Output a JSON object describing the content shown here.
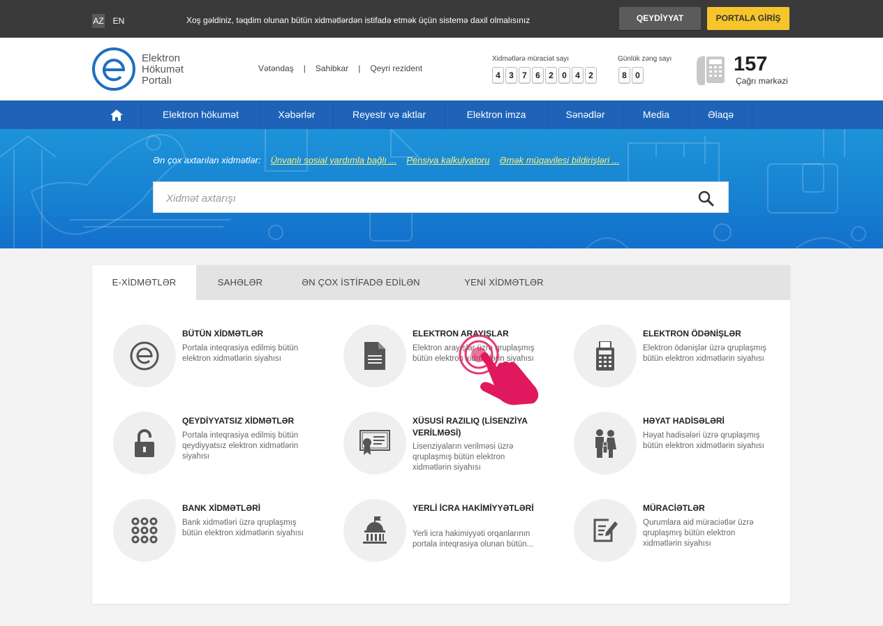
{
  "topbar": {
    "lang_az": "AZ",
    "lang_en": "EN",
    "welcome": "Xoş gəldiniz, təqdim olunan bütün xidmətlərdən istifadə etmək üçün sistemə daxil olmalısınız",
    "register_label": "QEYDİYYAT",
    "login_label": "PORTALA GİRİŞ"
  },
  "header": {
    "logo_line1": "Elektron",
    "logo_line2": "Hökumət",
    "logo_line3": "Portalı",
    "user_types": [
      "Vətəndaş",
      "Sahibkar",
      "Qeyri rezident"
    ],
    "requests_label": "Xidmətlərə müraciət sayı",
    "requests_digits": [
      "4",
      "3",
      "7",
      "6",
      "2",
      "0",
      "4",
      "2"
    ],
    "daily_calls_label": "Günlük zəng sayı",
    "daily_calls_digits": [
      "8",
      "0"
    ],
    "call_number": "157",
    "call_center_label": "Çağrı mərkəzi"
  },
  "nav": {
    "items": [
      "Elektron hökumət",
      "Xəbərlər",
      "Reyestr və aktlar",
      "Elektron imza",
      "Sənədlər",
      "Media",
      "Əlaqə"
    ]
  },
  "hero": {
    "popular_label": "Ən çox axtarılan xidmətlər:",
    "popular_links": [
      "Ünvanlı sosial yardımla bağlı ...",
      "Pensiya kalkulyatoru",
      "Əmək müqavilesi bildirişləri ..."
    ],
    "search_placeholder": "Xidmət axtarışı"
  },
  "tabs": [
    "E-XİDMƏTLƏR",
    "SAHƏLƏR",
    "ƏN ÇOX İSTİFADƏ EDİLƏN",
    "YENİ XİDMƏTLƏR"
  ],
  "services": [
    {
      "title": "BÜTÜN XİDMƏTLƏR",
      "desc": "Portala inteqrasiya edilmiş bütün elektron xidmətlərin siyahısı",
      "icon": "e-logo-icon"
    },
    {
      "title": "ELEKTRON ARAYIŞLAR",
      "desc": "Elektron arayışlar üzrə qruplaşmış bütün elektron xidmətlərin siyahısı",
      "icon": "document-icon"
    },
    {
      "title": "ELEKTRON ÖDƏNİŞLƏR",
      "desc": "Elektron ödənişlər üzrə qruplaşmış bütün elektron xidmətlərin siyahısı",
      "icon": "calculator-icon"
    },
    {
      "title": "QEYDİYYATSIZ XİDMƏTLƏR",
      "desc": "Portala inteqrasiya edilmiş bütün qeydiyyatsız elektron xidmətlərin siyahısı",
      "icon": "unlock-icon"
    },
    {
      "title": "XÜSUSİ RAZILIQ (LİSENZİYA VERİLMƏSİ)",
      "desc": "Lisenziyaların verilməsi üzrə qruplaşmış bütün elektron xidmətlərin siyahısı",
      "icon": "certificate-icon"
    },
    {
      "title": "HƏYAT HADİSƏLƏRİ",
      "desc": "Həyat hadisələri üzrə qruplaşmış bütün elektron xidmətlərin siyahısı",
      "icon": "family-icon"
    },
    {
      "title": "BANK XİDMƏTLƏRİ",
      "desc": "Bank xidmətləri üzrə qruplaşmış bütün elektron xidmətlərin siyahısı",
      "icon": "keypad-icon"
    },
    {
      "title": "YERLİ İCRA HAKİMİYYƏTLƏRİ",
      "desc": "Yerli icra hakimiyyəti orqanlarının portala inteqrasiya olunan bütün...",
      "icon": "government-building-icon"
    },
    {
      "title": "MÜRACİƏTLƏR",
      "desc": "Qurumlara aid müraciətlər üzrə qruplaşmış bütün elektron xidmətlərin siyahısı",
      "icon": "edit-document-icon"
    }
  ],
  "colors": {
    "topbar_bg": "#3a3a3a",
    "accent_yellow": "#f7c52b",
    "nav_blue": "#1e63b8",
    "hero_blue": "#1783d2",
    "pointer_pink": "#e0195f"
  }
}
